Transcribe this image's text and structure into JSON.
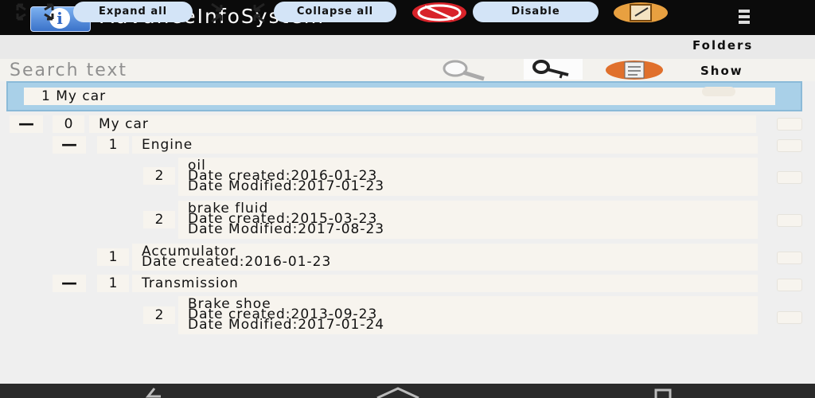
{
  "app": {
    "title": "AdvanceInfoSystem"
  },
  "toolbar": {
    "expand_all": "Expand all",
    "collapse_all": "Collapse all",
    "disable": "Disable",
    "folders": "Folders",
    "show": "Show"
  },
  "search": {
    "placeholder": "Search text",
    "value": ""
  },
  "path": {
    "label": "1 My car"
  },
  "tree": {
    "root": {
      "level": "0",
      "label": "My car",
      "toggle": "—"
    },
    "engine": {
      "level": "1",
      "label": "Engine",
      "toggle": "—"
    },
    "oil": {
      "level": "2",
      "lines": [
        "oil",
        "Date created:2016-01-23",
        "Date Modified:2017-01-23"
      ]
    },
    "brake_fluid": {
      "level": "2",
      "lines": [
        "brake fluid",
        "Date created:2015-03-23",
        "Date Modified:2017-08-23"
      ]
    },
    "accumulator": {
      "level": "1",
      "lines": [
        "Accumulator",
        "Date created:2016-01-23"
      ]
    },
    "transmission": {
      "level": "1",
      "label": "Transmission",
      "toggle": "—"
    },
    "brake_shoe": {
      "level": "2",
      "lines": [
        "Brake shoe",
        "Date created:2013-09-23",
        "Date Modified:2017-01-24"
      ]
    }
  },
  "icons": {
    "app": "info-icon",
    "menu": "overflow-menu-icon",
    "expand": "expand-arrows-icon",
    "collapse": "collapse-arrows-icon",
    "disable": "no-sign-icon",
    "folders": "notepad-icon",
    "search": "magnifier-icon",
    "key": "key-icon",
    "show": "document-icon"
  },
  "colors": {
    "titlebar": "#0b0b0b",
    "pill": "#d3e4f7",
    "pathbar": "#a9d0e8",
    "node": "#f7f4ee"
  }
}
